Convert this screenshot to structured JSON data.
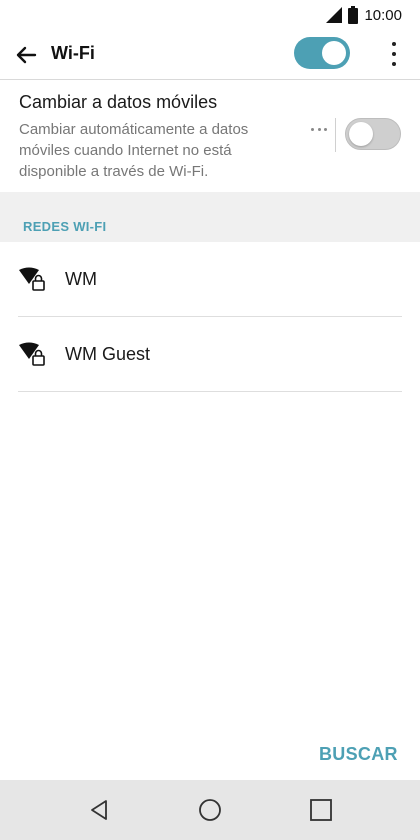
{
  "status_bar": {
    "time": "10:00",
    "icons": [
      "signal-icon",
      "battery-icon"
    ]
  },
  "app_bar": {
    "back_icon": "arrow-left-icon",
    "title": "Wi-Fi",
    "wifi_toggle_on": true,
    "more_icon": "more-vert-icon"
  },
  "mobile_data": {
    "title": "Cambiar a datos móviles",
    "description": "Cambiar automáticamente a datos móviles cuando Internet no está disponible a través de Wi-Fi.",
    "toggle_on": false,
    "settings_icon": "more-horiz-icon"
  },
  "section": {
    "header": "REDES WI-FI"
  },
  "networks": [
    {
      "name": "WM",
      "icon": "wifi-lock-icon",
      "secured": true
    },
    {
      "name": "WM Guest",
      "icon": "wifi-lock-icon",
      "secured": true
    }
  ],
  "actions": {
    "scan_label": "BUSCAR"
  },
  "nav_bar": {
    "buttons": [
      "back-triangle-icon",
      "home-circle-icon",
      "recents-square-icon"
    ]
  },
  "colors": {
    "accent": "#4da0b4",
    "toggle_off": "#cfcfcf",
    "section_bg": "#f0f0f0",
    "nav_bg": "#e6e6e6"
  }
}
